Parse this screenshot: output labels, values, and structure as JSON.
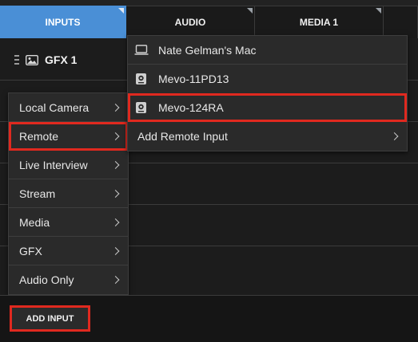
{
  "tabs": [
    {
      "label": "INPUTS",
      "active": true
    },
    {
      "label": "AUDIO",
      "active": false
    },
    {
      "label": "MEDIA 1",
      "active": false
    }
  ],
  "input_row": {
    "label": "GFX 1",
    "icon": "image-icon"
  },
  "add_input_menu": {
    "items": [
      {
        "label": "Local Camera",
        "has_submenu": true
      },
      {
        "label": "Remote",
        "has_submenu": true,
        "highlighted": true
      },
      {
        "label": "Live Interview",
        "has_submenu": true
      },
      {
        "label": "Stream",
        "has_submenu": true
      },
      {
        "label": "Media",
        "has_submenu": true
      },
      {
        "label": "GFX",
        "has_submenu": true
      },
      {
        "label": "Audio Only",
        "has_submenu": true
      }
    ]
  },
  "remote_submenu": {
    "items": [
      {
        "label": "Nate Gelman's Mac",
        "icon": "laptop-icon"
      },
      {
        "label": "Mevo-11PD13",
        "icon": "mevo-camera-icon"
      },
      {
        "label": "Mevo-124RA",
        "icon": "mevo-camera-icon",
        "highlighted": true
      },
      {
        "label": "Add Remote Input",
        "has_submenu": true
      }
    ]
  },
  "footer": {
    "add_input_label": "ADD INPUT"
  },
  "colors": {
    "accent": "#4a8fd6",
    "highlight": "#e0291f"
  }
}
